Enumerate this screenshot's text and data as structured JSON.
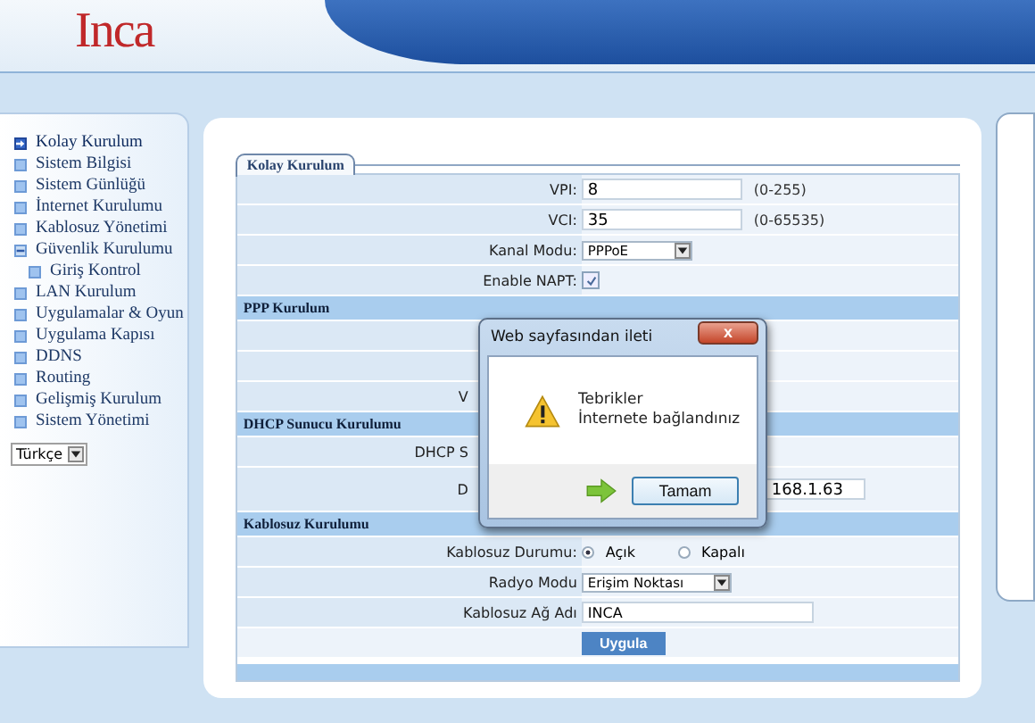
{
  "logo": {
    "text": "Inca"
  },
  "sidebar": {
    "items": [
      {
        "label": "Kolay Kurulum",
        "selected": true
      },
      {
        "label": "Sistem Bilgisi",
        "selected": false
      },
      {
        "label": "Sistem Günlüğü",
        "selected": false
      },
      {
        "label": "İnternet Kurulumu",
        "selected": false
      },
      {
        "label": "Kablosuz Yönetimi",
        "selected": false
      },
      {
        "label": "Güvenlik Kurulumu",
        "selected": false,
        "expanded": true,
        "children": [
          {
            "label": "Giriş Kontrol",
            "selected": false
          }
        ]
      },
      {
        "label": "LAN Kurulum",
        "selected": false
      },
      {
        "label": "Uygulamalar & Oyun",
        "selected": false
      },
      {
        "label": "Uygulama Kapısı",
        "selected": false
      },
      {
        "label": "DDNS",
        "selected": false
      },
      {
        "label": "Routing",
        "selected": false
      },
      {
        "label": "Gelişmiş Kurulum",
        "selected": false
      },
      {
        "label": "Sistem Yönetimi",
        "selected": false
      }
    ],
    "language": "Türkçe"
  },
  "tab": {
    "label": "Kolay Kurulum",
    "selected": true
  },
  "form_rows": [
    {
      "kind": "input",
      "label": "VPI:",
      "value": "8",
      "hint": "(0-255)"
    },
    {
      "kind": "input",
      "label": "VCI:",
      "value": "35",
      "hint": "(0-65535)"
    },
    {
      "kind": "select",
      "label": "Kanal Modu:",
      "value": "PPPoE"
    },
    {
      "kind": "checkbox",
      "label": "Enable NAPT:",
      "checked": true
    },
    {
      "kind": "header",
      "label": "PPP Kurulum"
    },
    {
      "kind": "blank"
    },
    {
      "kind": "blank"
    },
    {
      "kind": "partial",
      "label": "V"
    },
    {
      "kind": "header",
      "label": "DHCP Sunucu Kurulumu"
    },
    {
      "kind": "partial",
      "label": "DHCP S"
    },
    {
      "kind": "partial_input",
      "label": "D",
      "value": "168.1.63"
    },
    {
      "kind": "header",
      "label": "Kablosuz Kurulumu"
    },
    {
      "kind": "radio",
      "label": "Kablosuz Durumu:",
      "options": [
        {
          "label": "Açık",
          "selected": true
        },
        {
          "label": "Kapalı",
          "selected": false
        }
      ]
    },
    {
      "kind": "select",
      "label": "Radyo Modu",
      "value": "Erişim Noktası"
    },
    {
      "kind": "wide_input",
      "label": "Kablosuz Ağ Adı",
      "value": "INCA"
    },
    {
      "kind": "button",
      "label": "Uygula"
    }
  ],
  "dialog": {
    "title": "Web sayfasından ileti",
    "close": "x",
    "lines": [
      "Tebrikler",
      "İnternete bağlandınız"
    ],
    "button": "Tamam"
  }
}
